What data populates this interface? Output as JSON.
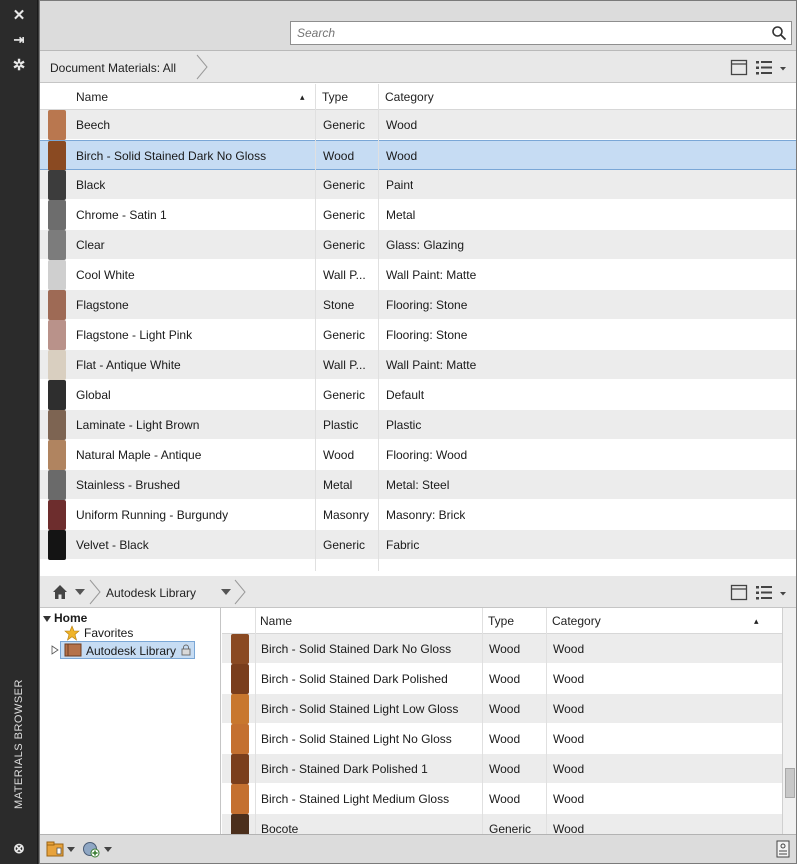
{
  "palette": {
    "strip_bg": "#2b2b2b",
    "selection": "#c6dcf3",
    "alt_row": "#ececec",
    "wood_swatch": "#a0522d"
  },
  "strip": {
    "close_glyph": "✕",
    "autohide_glyph": "⇥",
    "settings_glyph": "✲",
    "title": "MATERIALS BROWSER",
    "bottom_glyph": "⊗"
  },
  "search": {
    "placeholder": "Search",
    "icon": "search-icon"
  },
  "doc_materials": {
    "breadcrumb": "Document Materials: All",
    "columns": {
      "name": "Name",
      "type": "Type",
      "category": "Category",
      "sort_glyph": "▴"
    },
    "rows": [
      {
        "name": "Beech",
        "type": "Generic",
        "category": "Wood",
        "swatch": "#b9774f"
      },
      {
        "name": "Birch - Solid Stained Dark No Gloss",
        "type": "Wood",
        "category": "Wood",
        "swatch": "#8a4a22"
      },
      {
        "name": "Black",
        "type": "Generic",
        "category": "Paint",
        "swatch": "#3c3c3c"
      },
      {
        "name": "Chrome - Satin 1",
        "type": "Generic",
        "category": "Metal",
        "swatch": "#6d6d6d"
      },
      {
        "name": "Clear",
        "type": "Generic",
        "category": "Glass: Glazing",
        "swatch": "#7c7c7c"
      },
      {
        "name": "Cool White",
        "type": "Wall P...",
        "category": "Wall Paint: Matte",
        "swatch": "#cfcfcf"
      },
      {
        "name": "Flagstone",
        "type": "Stone",
        "category": "Flooring: Stone",
        "swatch": "#9e6a55"
      },
      {
        "name": "Flagstone - Light Pink",
        "type": "Generic",
        "category": "Flooring: Stone",
        "swatch": "#b9928a"
      },
      {
        "name": "Flat - Antique White",
        "type": "Wall P...",
        "category": "Wall Paint: Matte",
        "swatch": "#d9cfc0"
      },
      {
        "name": "Global",
        "type": "Generic",
        "category": "Default",
        "swatch": "#2e2e2e"
      },
      {
        "name": "Laminate - Light Brown",
        "type": "Plastic",
        "category": "Plastic",
        "swatch": "#7d6452"
      },
      {
        "name": "Natural Maple - Antique",
        "type": "Wood",
        "category": "Flooring: Wood",
        "swatch": "#b08460"
      },
      {
        "name": "Stainless - Brushed",
        "type": "Metal",
        "category": "Metal: Steel",
        "swatch": "#6a6a6a"
      },
      {
        "name": "Uniform Running - Burgundy",
        "type": "Masonry",
        "category": "Masonry: Brick",
        "swatch": "#6d2d2d"
      },
      {
        "name": "Velvet - Black",
        "type": "Generic",
        "category": "Fabric",
        "swatch": "#141414"
      }
    ],
    "selected_index": 1
  },
  "library": {
    "breadcrumb": "Autodesk Library",
    "tree": {
      "home": "Home",
      "favorites": "Favorites",
      "autodesk_library": "Autodesk Library"
    },
    "columns": {
      "name": "Name",
      "type": "Type",
      "category": "Category",
      "sort_glyph": "▴"
    },
    "rows": [
      {
        "name": "Birch - Solid Stained Dark No Gloss",
        "type": "Wood",
        "category": "Wood",
        "swatch": "#8a4a22"
      },
      {
        "name": "Birch - Solid Stained Dark Polished",
        "type": "Wood",
        "category": "Wood",
        "swatch": "#7a3e1c"
      },
      {
        "name": "Birch - Solid Stained Light Low Gloss",
        "type": "Wood",
        "category": "Wood",
        "swatch": "#c8772e"
      },
      {
        "name": "Birch - Solid Stained Light No Gloss",
        "type": "Wood",
        "category": "Wood",
        "swatch": "#c47030"
      },
      {
        "name": "Birch - Stained Dark Polished 1",
        "type": "Wood",
        "category": "Wood",
        "swatch": "#7a3e1c"
      },
      {
        "name": "Birch - Stained Light Medium Gloss",
        "type": "Wood",
        "category": "Wood",
        "swatch": "#c47030"
      },
      {
        "name": "Bocote",
        "type": "Generic",
        "category": "Wood",
        "swatch": "#4b2f1c"
      }
    ]
  }
}
